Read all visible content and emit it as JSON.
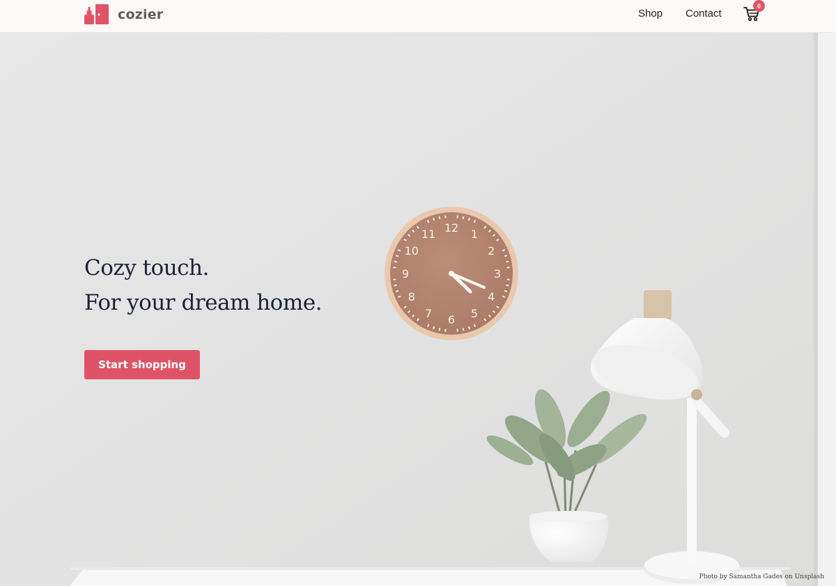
{
  "brand": {
    "name": "cozier",
    "color": "#e05468"
  },
  "nav": {
    "links": [
      {
        "label": "Shop"
      },
      {
        "label": "Contact"
      }
    ],
    "cart_count": "0"
  },
  "hero": {
    "headline_line1": "Cozy touch.",
    "headline_line2": "For your dream home.",
    "cta_label": "Start shopping",
    "photo_credit": "Photo by Samantha Gades on Unsplash",
    "clock_numbers": [
      "12",
      "1",
      "2",
      "3",
      "4",
      "5",
      "6",
      "7",
      "8",
      "9",
      "10",
      "11"
    ]
  },
  "icons": {
    "cart": "shopping-cart-icon",
    "logo": "cozier-logo-icon"
  }
}
